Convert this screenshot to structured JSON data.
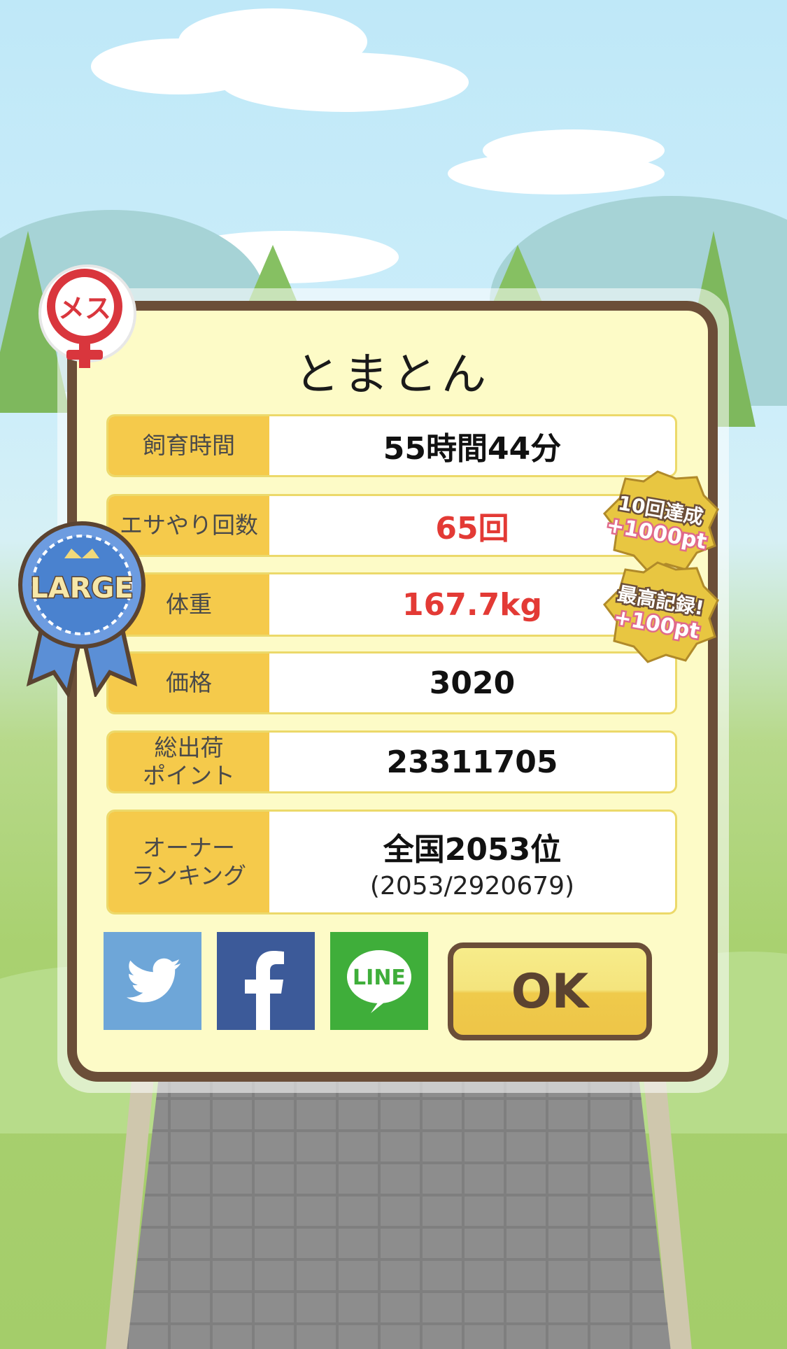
{
  "dialog": {
    "title": "とまとん",
    "gender_badge": "メス",
    "size_badge": "LARGE",
    "ok_label": "OK",
    "line_label": "LINE"
  },
  "stats": [
    {
      "label": "飼育時間",
      "value": "55時間44分"
    },
    {
      "label": "エサやり回数",
      "value": "65回"
    },
    {
      "label": "体重",
      "value": "167.7kg"
    },
    {
      "label": "価格",
      "value": "3020"
    },
    {
      "label": "総出荷\nポイント",
      "value": "23311705"
    },
    {
      "label": "オーナー\nランキング",
      "value": "全国2053位",
      "sub": "(2053/2920679)"
    }
  ],
  "achievements": [
    {
      "title": "10回達成",
      "bonus": "+1000pt"
    },
    {
      "title": "最高記録!",
      "bonus": "+100pt"
    }
  ],
  "colors": {
    "highlight_red": "#e33a35",
    "label_bg": "#f5ca4b",
    "frame": "#6b4e38",
    "panel": "#fdfbc7"
  }
}
